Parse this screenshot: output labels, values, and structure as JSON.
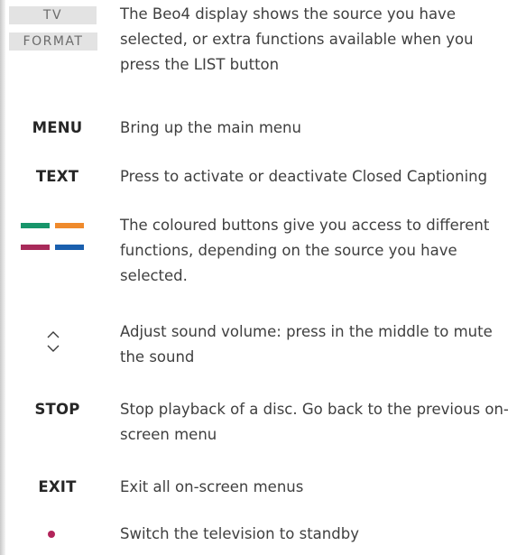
{
  "display": {
    "source_label": "TV",
    "function_label": "FORMAT",
    "description": "The Beo4 display shows the source you have selected, or extra functions available when you press the LIST button"
  },
  "menu": {
    "key_label": "MENU",
    "description": "Bring up the main menu"
  },
  "text": {
    "key_label": "TEXT",
    "description": "Press to activate or deactivate Closed Captioning"
  },
  "coloured_buttons": {
    "colors": {
      "green": "#17956a",
      "orange": "#ef8a2c",
      "red": "#a82a5a",
      "blue": "#1a5fae"
    },
    "description": "The coloured buttons give you access to different functions, depending on the source you have selected."
  },
  "volume": {
    "icons": [
      "up-arrow-icon",
      "down-arrow-icon"
    ],
    "description": "Adjust sound volume: press in the middle to mute the sound"
  },
  "stop": {
    "key_label": "STOP",
    "description": "Stop playback of a disc. Go back to the previous on-screen menu"
  },
  "exit": {
    "key_label": "EXIT",
    "description": "Exit all on-screen menus"
  },
  "standby": {
    "dot_color": "#b2245a",
    "description": "Switch the television to standby"
  }
}
